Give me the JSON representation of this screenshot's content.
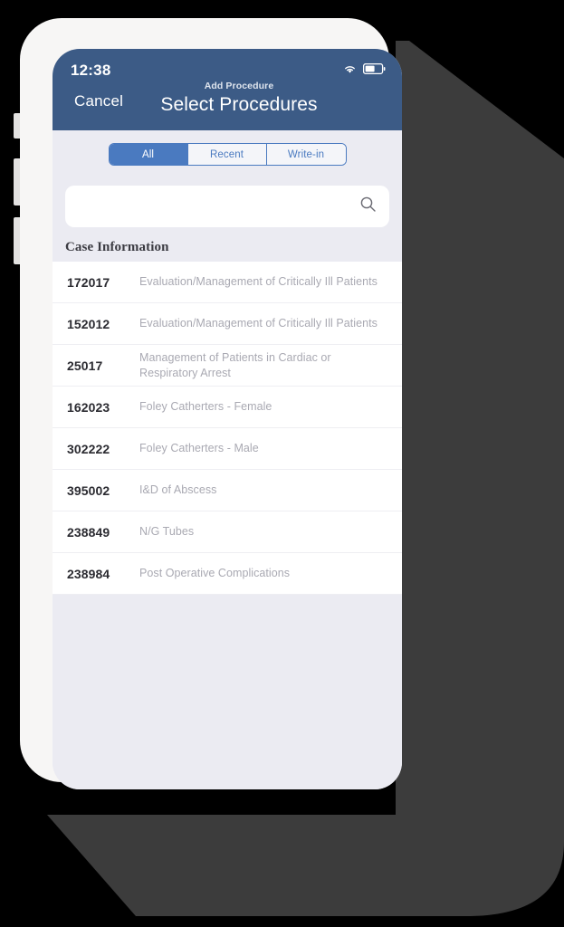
{
  "status_bar": {
    "time": "12:38",
    "wifi_icon": "wifi-icon",
    "battery_icon": "battery-icon"
  },
  "navbar": {
    "cancel_label": "Cancel",
    "subtitle": "Add Procedure",
    "title": "Select Procedures",
    "background": "#3c5b86"
  },
  "segmented_control": {
    "accent": "#4a7ac0",
    "selected": "All",
    "options": [
      {
        "label": "All",
        "selected": true
      },
      {
        "label": "Recent",
        "selected": false
      },
      {
        "label": "Write-in",
        "selected": false
      }
    ]
  },
  "search": {
    "value": "",
    "placeholder": "",
    "icon": "search-icon"
  },
  "list": {
    "section_header": "Case Information",
    "rows": [
      {
        "code": "172017",
        "description": "Evaluation/Management of Critically Ill Patients"
      },
      {
        "code": "152012",
        "description": "Evaluation/Management of Critically Ill Patients"
      },
      {
        "code": "25017",
        "description": "Management of Patients in Cardiac or Respiratory Arrest"
      },
      {
        "code": "162023",
        "description": "Foley Catherters - Female"
      },
      {
        "code": "302222",
        "description": "Foley Catherters - Male"
      },
      {
        "code": "395002",
        "description": "I&D of Abscess"
      },
      {
        "code": "238849",
        "description": "N/G Tubes"
      },
      {
        "code": "238984",
        "description": "Post Operative Complications"
      }
    ]
  },
  "device": {
    "frame_color": "#f7f6f5",
    "screen_background": "#ebebf2",
    "buttons": [
      "silent-switch",
      "volume-up",
      "volume-down",
      "power-button"
    ]
  }
}
